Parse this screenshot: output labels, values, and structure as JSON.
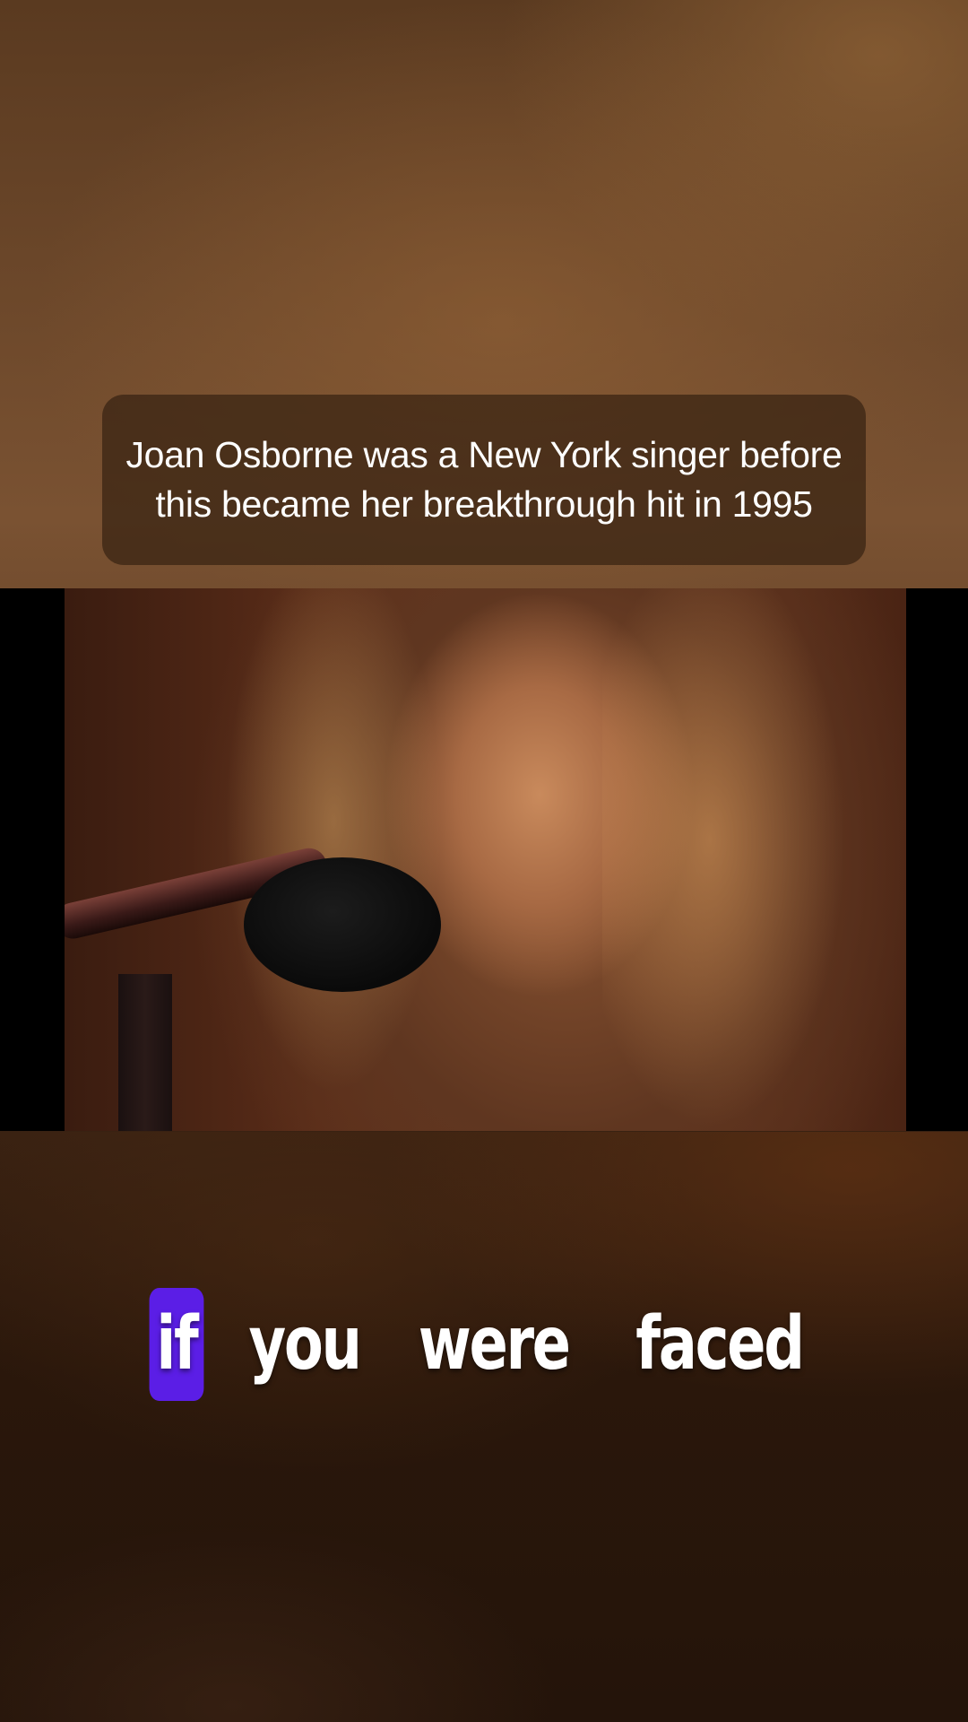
{
  "caption": {
    "text": "Joan Osborne was a New York singer before this became her breakthrough hit in 1995"
  },
  "lyrics": {
    "words": [
      "if",
      "you",
      "were",
      "faced"
    ],
    "active_index": 0,
    "highlight_color": "#5b1ee6"
  },
  "video": {
    "subject": "singer-at-microphone"
  }
}
